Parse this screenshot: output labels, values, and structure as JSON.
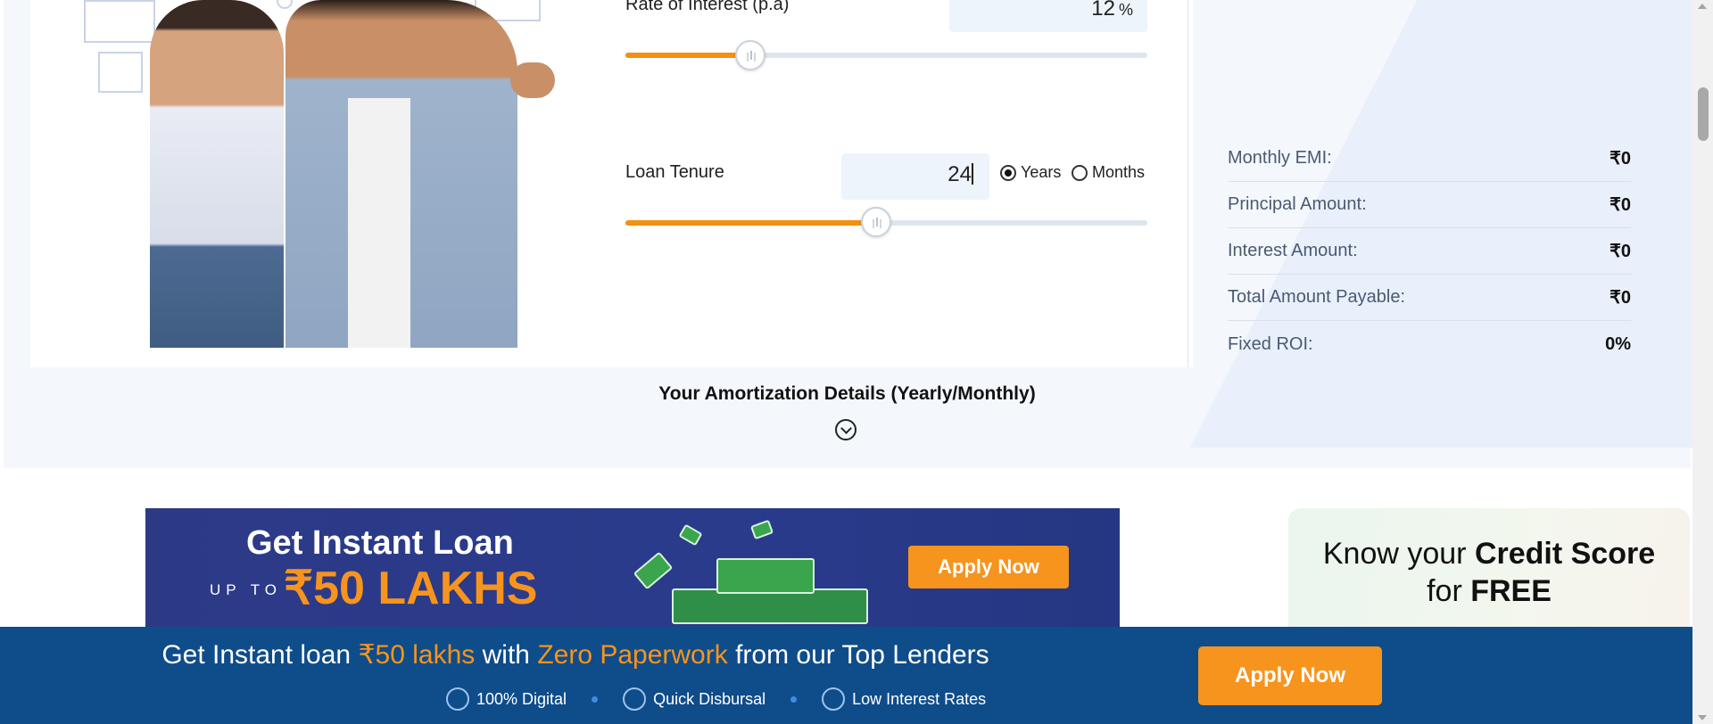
{
  "calculator": {
    "interest": {
      "label": "Rate of Interest (p.a)",
      "value": "12",
      "unit": "%",
      "slider_fraction": 0.24
    },
    "tenure": {
      "label": "Loan Tenure",
      "value": "24",
      "slider_fraction": 0.48,
      "unit_options": [
        "Years",
        "Months"
      ],
      "selected_unit": "Years"
    },
    "results": [
      {
        "label": "Monthly EMI:",
        "value": "₹0"
      },
      {
        "label": "Principal Amount:",
        "value": "₹0"
      },
      {
        "label": "Interest Amount:",
        "value": "₹0"
      },
      {
        "label": "Total Amount Payable:",
        "value": "₹0"
      },
      {
        "label": "Fixed ROI:",
        "value": "0%"
      }
    ],
    "amortization_label": "Your Amortization Details (Yearly/Monthly)"
  },
  "banner": {
    "title": "Get Instant Loan",
    "upto": "UP TO",
    "amount": "₹50 LAKHS",
    "cta": "Apply Now"
  },
  "credit_card": {
    "line1_pre": "Know your ",
    "line1_bold": "Credit Score",
    "line2_pre": "for ",
    "line2_bold": "FREE"
  },
  "sticky": {
    "h1": "Get Instant loan ",
    "h2": "₹50 lakhs",
    "h3": " with ",
    "h4": "Zero Paperwork",
    "h5": " from our Top Lenders",
    "features": [
      "100% Digital",
      "Quick Disbursal",
      "Low Interest Rates"
    ],
    "cta": "Apply Now"
  },
  "colors": {
    "accent": "#f7941d",
    "slider_fill": "#f29111",
    "sticky_bg": "#0f4c8a",
    "banner_bg": "#2c3a86"
  },
  "icons": {
    "chevron": "chevron-down-icon",
    "features": [
      "digital-icon",
      "disbursal-icon",
      "percent-icon"
    ]
  }
}
